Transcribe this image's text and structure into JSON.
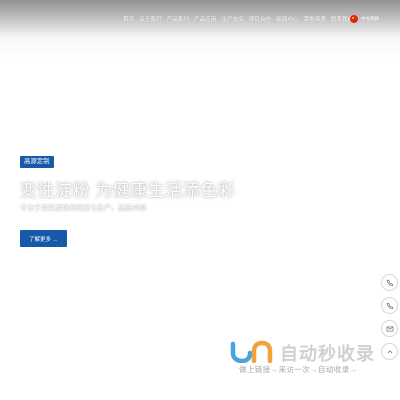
{
  "nav": {
    "items": [
      "首页",
      "关于我们",
      "产品系列",
      "产品应用",
      "生产车间",
      "项目合作",
      "新闻中心",
      "荣誉资质",
      "联系我们"
    ]
  },
  "language": {
    "label": "中文简体"
  },
  "hero": {
    "badge": "高源定制",
    "title": "变性淀粉 为健康生活添色彩",
    "subtitle": "专注于变性淀粉的研发与生产，品质卓越",
    "cta_label": "了解更多 →"
  },
  "side_tools": [
    {
      "icon": "phone-icon"
    },
    {
      "icon": "phone-icon"
    },
    {
      "icon": "mail-icon"
    },
    {
      "icon": "arrow-up-icon"
    }
  ],
  "watermark": {
    "title": "自动秒收录",
    "subtitle": "做上链接→来访一次→自动收录→"
  },
  "colors": {
    "brand_blue": "#1659a8",
    "watermark_blue": "#4aa3df",
    "watermark_orange": "#f2a33a"
  }
}
